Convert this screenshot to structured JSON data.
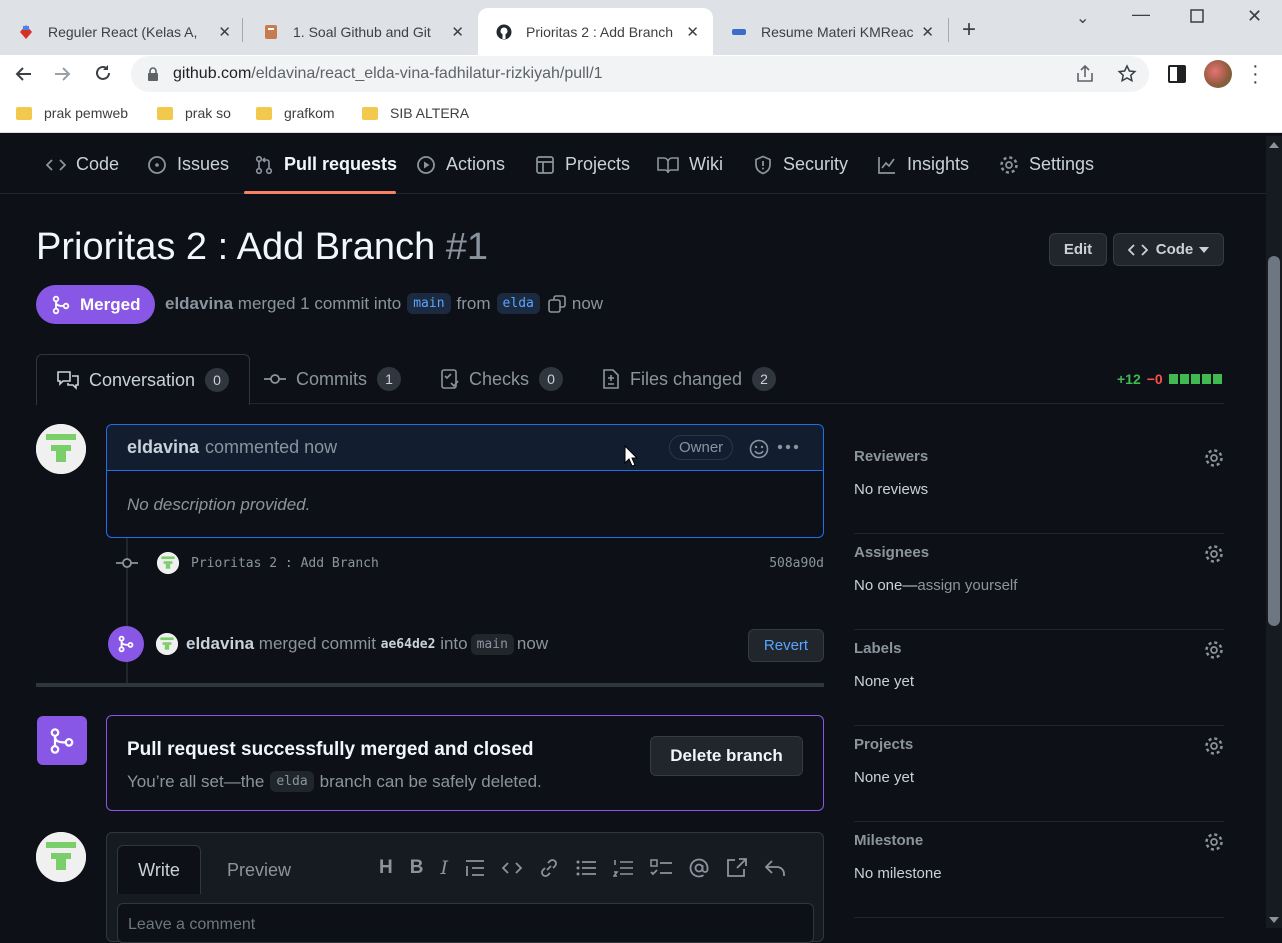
{
  "browser": {
    "tabs": [
      {
        "title": "Reguler React (Kelas A,",
        "favicon_color": "#e8eaed"
      },
      {
        "title": "1. Soal Github and Git",
        "favicon_color": "#c77b4e"
      },
      {
        "title": "Prioritas 2 : Add Branch",
        "favicon_color": "#24292f"
      },
      {
        "title": "Resume Materi KMReac",
        "favicon_color": "#3b6ecc"
      }
    ],
    "url_host": "github.com",
    "url_path": "/eldavina/react_elda-vina-fadhilatur-rizkiyah/pull/1",
    "bookmarks": [
      "prak pemweb",
      "prak so",
      "grafkom",
      "SIB ALTERA"
    ]
  },
  "repo_nav": {
    "items": [
      "Code",
      "Issues",
      "Pull requests",
      "Actions",
      "Projects",
      "Wiki",
      "Security",
      "Insights",
      "Settings"
    ]
  },
  "pr": {
    "title": "Prioritas 2 : Add Branch",
    "number": "#1",
    "edit_label": "Edit",
    "code_label": "Code",
    "state": "Merged",
    "author": "eldavina",
    "merged_text": "merged 1 commit into",
    "base_branch": "main",
    "from_text": "from",
    "head_branch": "elda",
    "time": "now"
  },
  "tabs": [
    {
      "label": "Conversation",
      "count": "0"
    },
    {
      "label": "Commits",
      "count": "1"
    },
    {
      "label": "Checks",
      "count": "0"
    },
    {
      "label": "Files changed",
      "count": "2"
    }
  ],
  "diffstat": {
    "added": "+12",
    "removed": "−0",
    "colors": {
      "add": "#3fb950",
      "del": "#f85149"
    }
  },
  "comment": {
    "author": "eldavina",
    "action": "commented now",
    "badge": "Owner",
    "body": "No description provided."
  },
  "commit": {
    "message": "Prioritas 2 : Add Branch",
    "sha": "508a90d"
  },
  "merge_event": {
    "author": "eldavina",
    "text1": "merged commit",
    "sha": "ae64de2",
    "text2": "into",
    "branch": "main",
    "time": "now",
    "revert_label": "Revert"
  },
  "merged_box": {
    "heading": "Pull request successfully merged and closed",
    "sub_prefix": "You’re all set—the",
    "branch": "elda",
    "sub_suffix": "branch can be safely deleted.",
    "delete_label": "Delete branch"
  },
  "editor": {
    "write_tab": "Write",
    "preview_tab": "Preview",
    "placeholder": "Leave a comment"
  },
  "sidebar": {
    "reviewers": {
      "heading": "Reviewers",
      "value": "No reviews"
    },
    "assignees": {
      "heading": "Assignees",
      "value_prefix": "No one—",
      "value_link": "assign yourself"
    },
    "labels": {
      "heading": "Labels",
      "value": "None yet"
    },
    "projects": {
      "heading": "Projects",
      "value": "None yet"
    },
    "milestone": {
      "heading": "Milestone",
      "value": "No milestone"
    }
  }
}
